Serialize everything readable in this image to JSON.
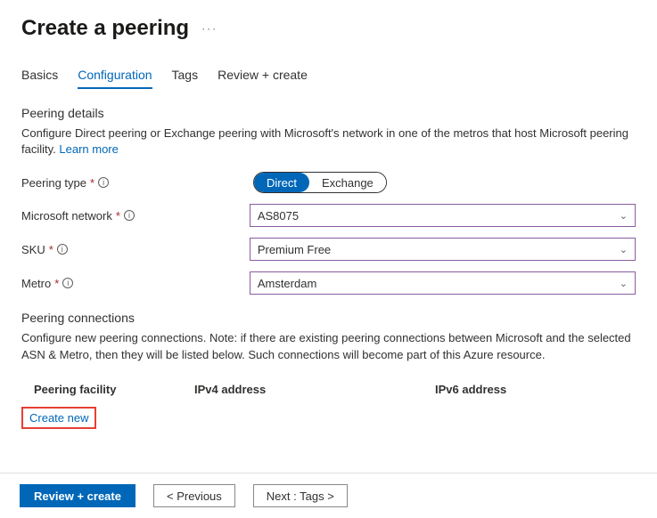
{
  "header": {
    "title": "Create a peering"
  },
  "tabs": [
    {
      "label": "Basics"
    },
    {
      "label": "Configuration"
    },
    {
      "label": "Tags"
    },
    {
      "label": "Review + create"
    }
  ],
  "active_tab": 1,
  "details": {
    "title": "Peering details",
    "description": "Configure Direct peering or Exchange peering with Microsoft's network in one of the metros that host Microsoft peering facility. ",
    "learn_more": "Learn more"
  },
  "form": {
    "peering_type": {
      "label": "Peering type",
      "options": [
        "Direct",
        "Exchange"
      ],
      "selected": "Direct"
    },
    "ms_network": {
      "label": "Microsoft network",
      "value": "AS8075"
    },
    "sku": {
      "label": "SKU",
      "value": "Premium Free"
    },
    "metro": {
      "label": "Metro",
      "value": "Amsterdam"
    }
  },
  "connections": {
    "title": "Peering connections",
    "description": "Configure new peering connections. Note: if there are existing peering connections between Microsoft and the selected ASN & Metro, then they will be listed below. Such connections will become part of this Azure resource.",
    "columns": {
      "facility": "Peering facility",
      "ipv4": "IPv4 address",
      "ipv6": "IPv6 address"
    },
    "create_new": "Create new"
  },
  "footer": {
    "review": "Review + create",
    "previous": "< Previous",
    "next": "Next : Tags >"
  }
}
